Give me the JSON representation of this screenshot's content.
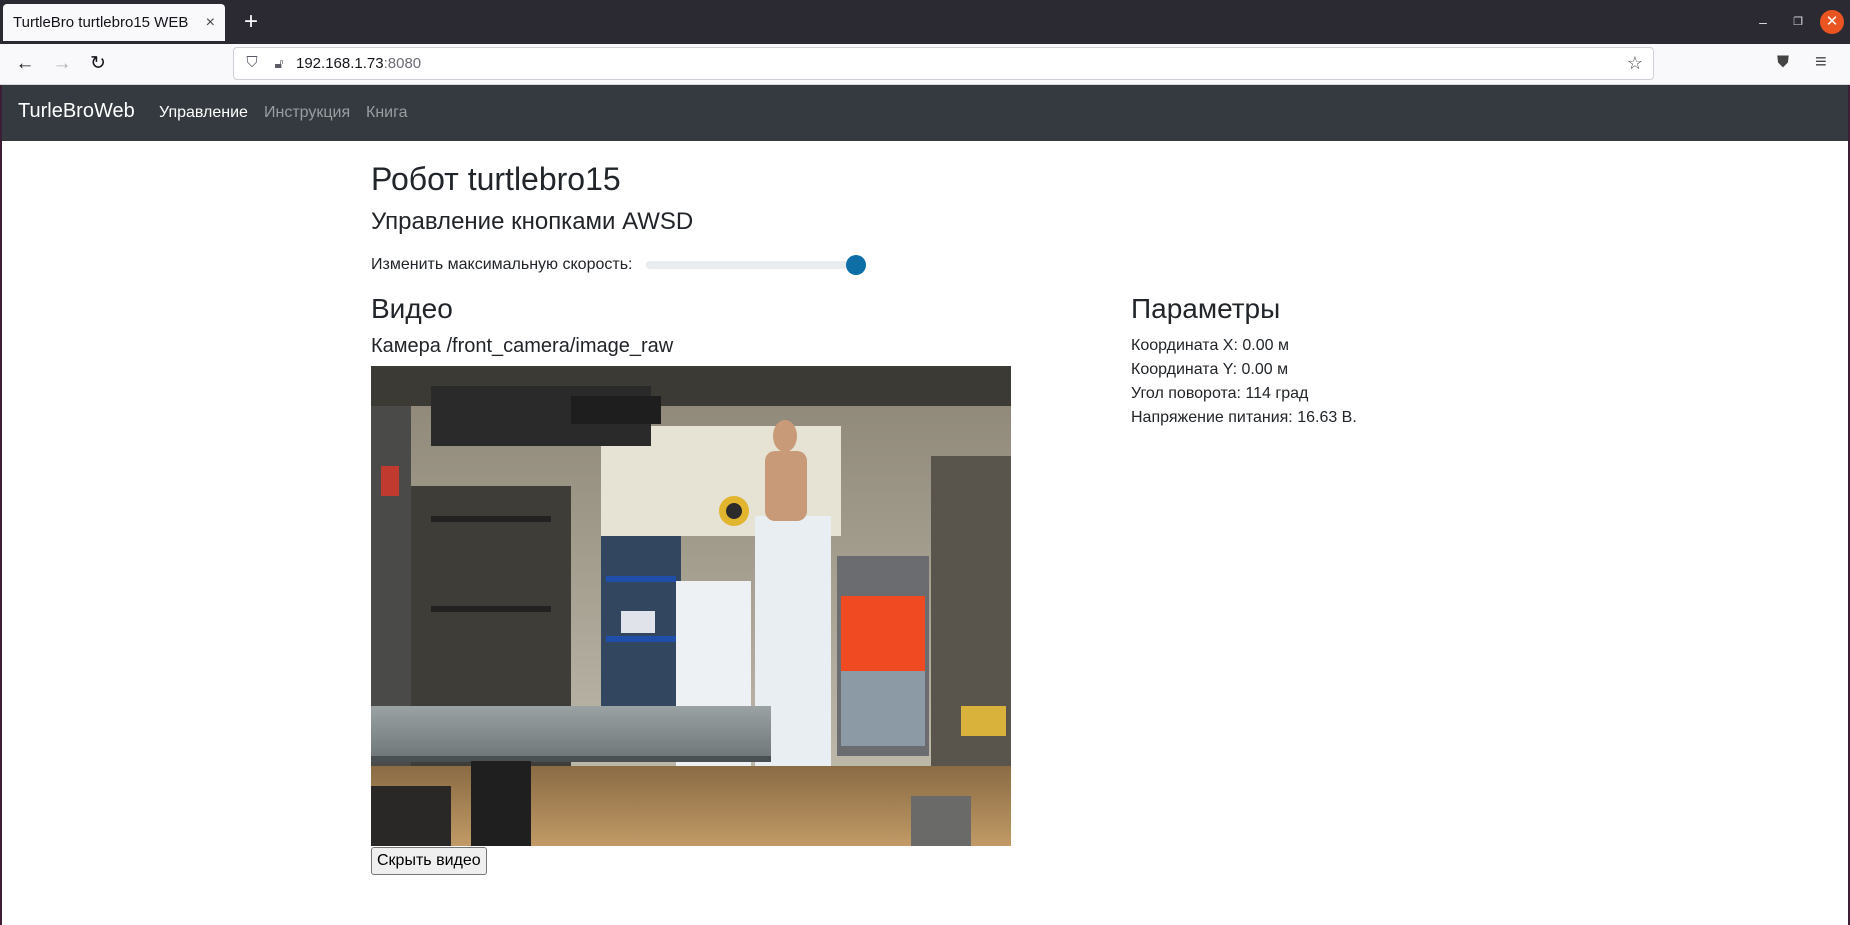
{
  "browser": {
    "tab_title": "TurtleBro turtlebro15 WEB",
    "tab_close": "×",
    "new_tab": "+",
    "url_host": "192.168.1.73",
    "url_port": ":8080"
  },
  "site": {
    "brand": "TurleBroWeb",
    "nav": [
      "Управление",
      "Инструкция",
      "Книга"
    ],
    "title": "Робот turtlebro15",
    "subtitle": "Управление кнопками AWSD",
    "speed_label": "Изменить максимальную скорость:",
    "speed_level": 1.0,
    "video_heading": "Видео",
    "camera_heading": "Камера /front_camera/image_raw",
    "hide_video_button": "Скрыть видео",
    "params_heading": "Параметры",
    "params": [
      "Координата X: 0.00 м",
      "Координата Y: 0.00 м",
      "Угол поворота: 114 град",
      "Напряжение питания: 16.63 В."
    ]
  },
  "icons": {
    "back": "arrow-left-icon",
    "forward": "arrow-right-icon",
    "reload": "reload-icon",
    "shield": "shield-icon",
    "lock": "lock-icon",
    "star": "star-icon",
    "pocket": "pocket-icon",
    "menu": "hamburger-menu-icon"
  },
  "colors": {
    "navbar_bg": "#343a40",
    "slider_thumb": "#0d6fa6",
    "window_close": "#e95420"
  }
}
